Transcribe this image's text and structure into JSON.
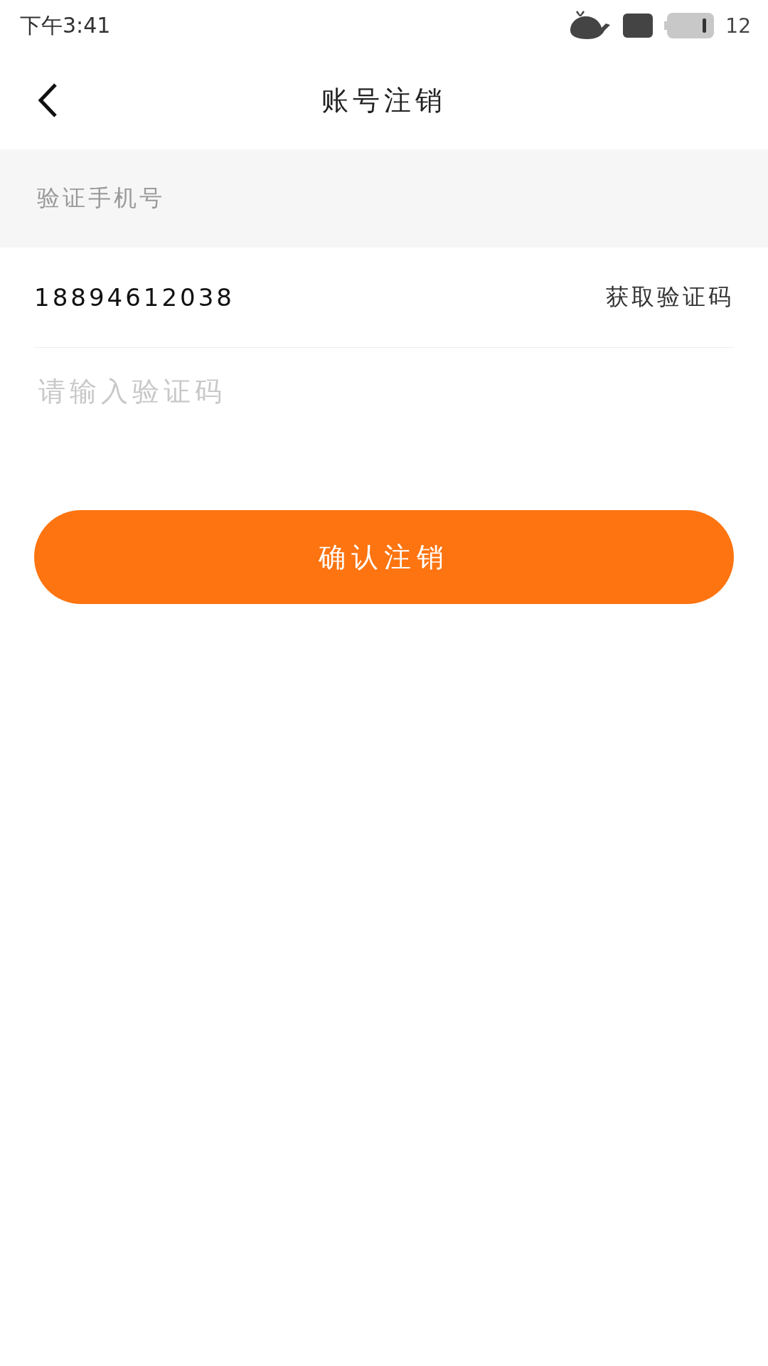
{
  "status_bar": {
    "time": "下午3:41",
    "battery_text": "12"
  },
  "header": {
    "title": "账号注销"
  },
  "section": {
    "label": "验证手机号"
  },
  "phone_row": {
    "value": "18894612038",
    "action": "获取验证码"
  },
  "code_field": {
    "placeholder": "请输入验证码"
  },
  "confirm_button": {
    "label": "确认注销"
  }
}
